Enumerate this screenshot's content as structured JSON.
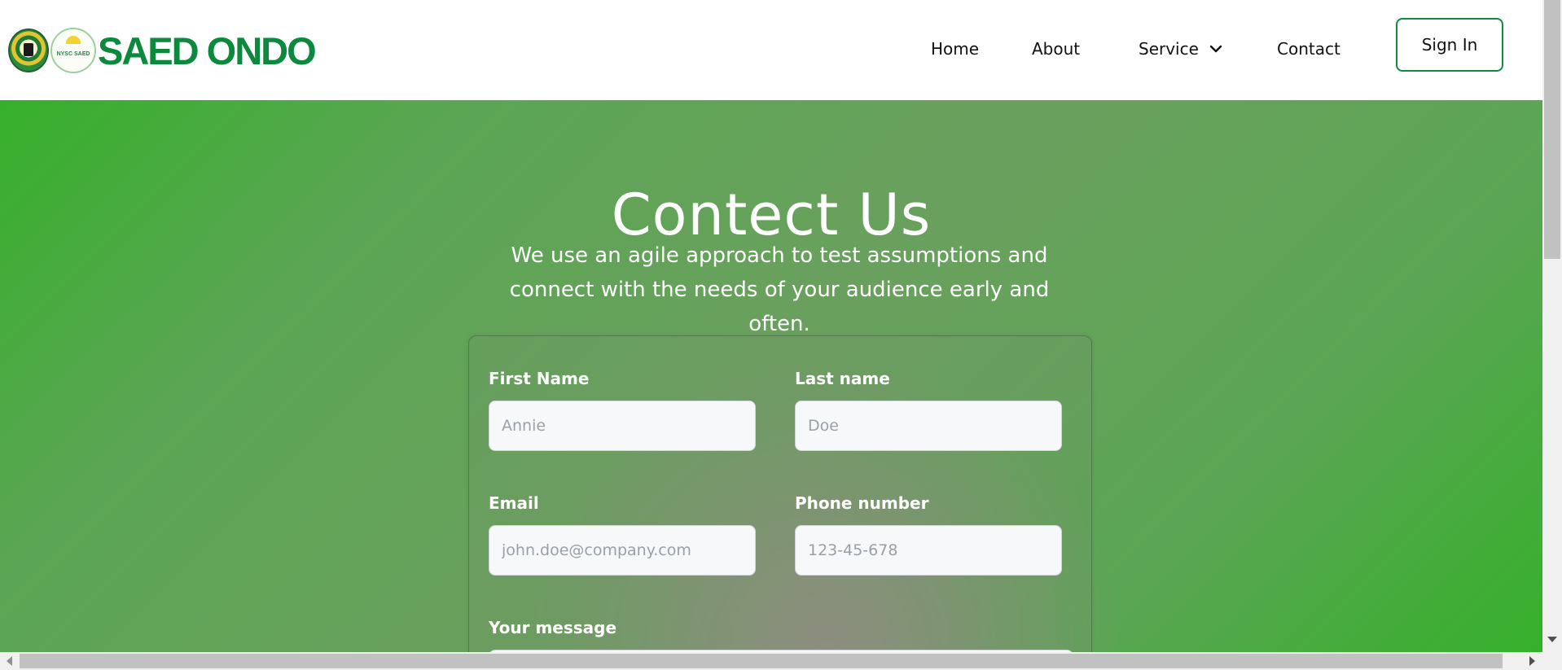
{
  "header": {
    "brand": "SAED ONDO",
    "seal_text": "NYSC SAED",
    "nav": {
      "home": "Home",
      "about": "About",
      "service": "Service",
      "contact": "Contact"
    },
    "sign_in": "Sign In",
    "brand_color": "#0b8a3e"
  },
  "hero": {
    "title": "Contect Us",
    "subtitle": "We use an agile approach to test assumptions and connect with the needs of your audience early and often."
  },
  "form": {
    "first_name": {
      "label": "First Name",
      "placeholder": "Annie"
    },
    "last_name": {
      "label": "Last name",
      "placeholder": "Doe"
    },
    "email": {
      "label": "Email",
      "placeholder": "john.doe@company.com"
    },
    "phone": {
      "label": "Phone number",
      "placeholder": "123-45-678"
    },
    "message": {
      "label": "Your message"
    }
  },
  "icons": {
    "service_dropdown": "chevron-down-icon"
  }
}
